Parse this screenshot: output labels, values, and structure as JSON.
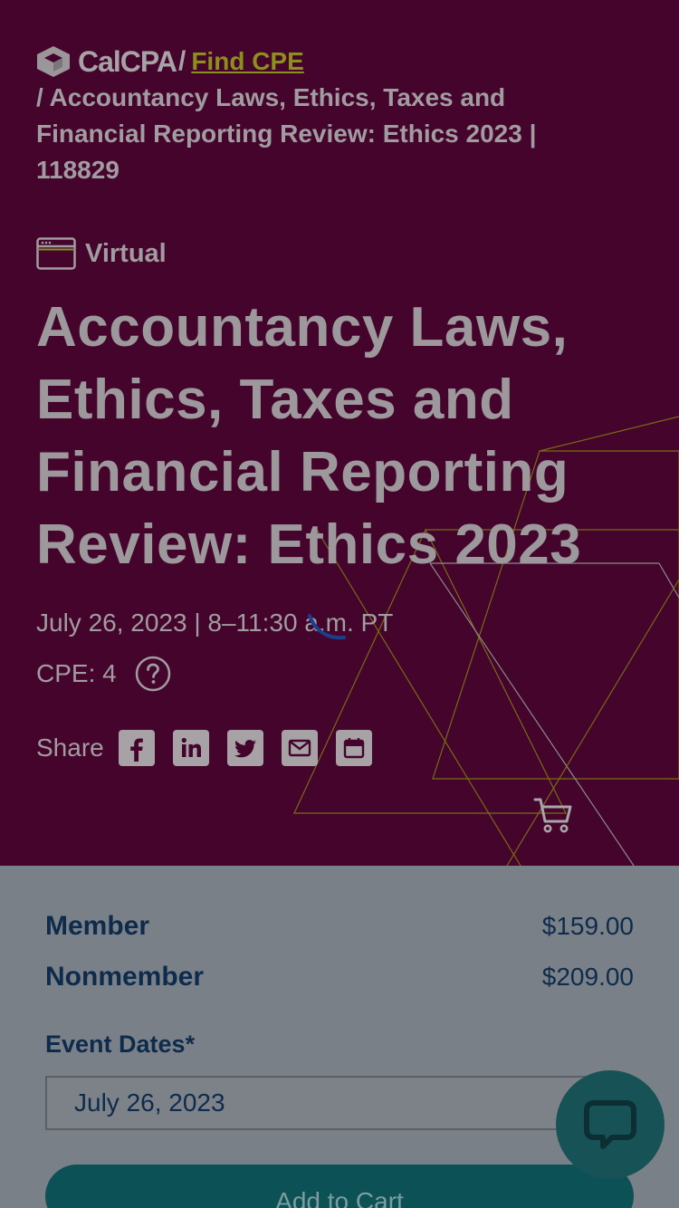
{
  "breadcrumb": {
    "logo_text": "CalCPA",
    "separator": "/",
    "link_text": "Find CPE",
    "current": "/ Accountancy Laws, Ethics, Taxes and Financial Reporting Review: Ethics 2023 | 118829"
  },
  "event": {
    "format": "Virtual",
    "format_icon": "browser-window-icon",
    "title": "Accountancy Laws, Ethics, Taxes and Financial Reporting Review: Ethics 2023",
    "date_time": "July 26, 2023 | 8–11:30 a.m. PT",
    "cpe": "CPE: 4",
    "help_icon": "question-circle-icon"
  },
  "share": {
    "label": "Share",
    "buttons": [
      "facebook-icon",
      "linkedin-icon",
      "twitter-icon",
      "email-icon",
      "calendar-icon"
    ]
  },
  "pricing": {
    "member_label": "Member",
    "member_price": "$159.00",
    "nonmember_label": "Nonmember",
    "nonmember_price": "$209.00"
  },
  "registration": {
    "dates_label": "Event Dates*",
    "selected_date": "July 26, 2023",
    "add_to_cart_label": "Add to Cart"
  },
  "colors": {
    "hero_background": "#45042c",
    "panel_background": "#7a8088",
    "accent_link": "#8c8e1e",
    "primary_text": "#0f2b4c",
    "button_teal": "#0c5156"
  }
}
